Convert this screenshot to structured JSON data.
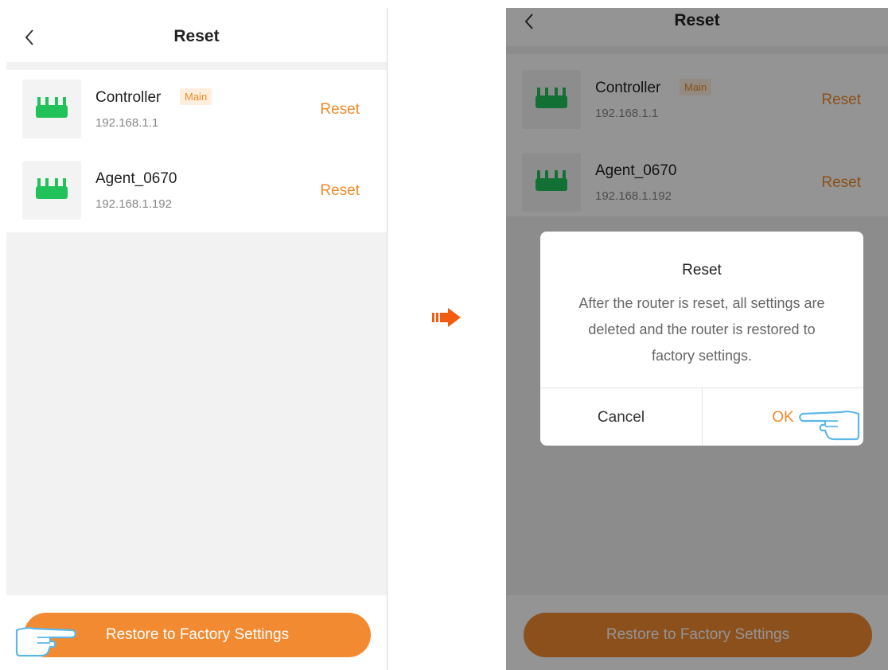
{
  "left_screen": {
    "header": {
      "title": "Reset",
      "back_icon": "chevron-left-icon"
    },
    "devices": [
      {
        "name": "Controller",
        "badge": "Main",
        "ip": "192.168.1.1",
        "action": "Reset",
        "icon": "router-icon"
      },
      {
        "name": "Agent_0670",
        "badge": "",
        "ip": "192.168.1.192",
        "action": "Reset",
        "icon": "router-icon"
      }
    ],
    "restore_button": "Restore to Factory Settings"
  },
  "right_screen": {
    "header": {
      "title": "Reset",
      "back_icon": "chevron-left-icon"
    },
    "devices": [
      {
        "name": "Controller",
        "badge": "Main",
        "ip": "192.168.1.1",
        "action": "Reset",
        "icon": "router-icon"
      },
      {
        "name": "Agent_0670",
        "badge": "",
        "ip": "192.168.1.192",
        "action": "Reset",
        "icon": "router-icon"
      }
    ],
    "restore_button": "Restore to Factory Settings",
    "dialog": {
      "title": "Reset",
      "message": "After the router is reset, all settings are deleted and the router is restored to factory settings.",
      "cancel": "Cancel",
      "ok": "OK"
    }
  },
  "colors": {
    "accent": "#f28a32",
    "accent_text": "#f08a2a",
    "router_green": "#22c25a",
    "flow_arrow": "#f25c10",
    "pointer_hand": "#5bb7e8"
  },
  "icons": [
    "chevron-left-icon",
    "router-icon",
    "right-arrow-icon",
    "pointing-hand-icon"
  ]
}
